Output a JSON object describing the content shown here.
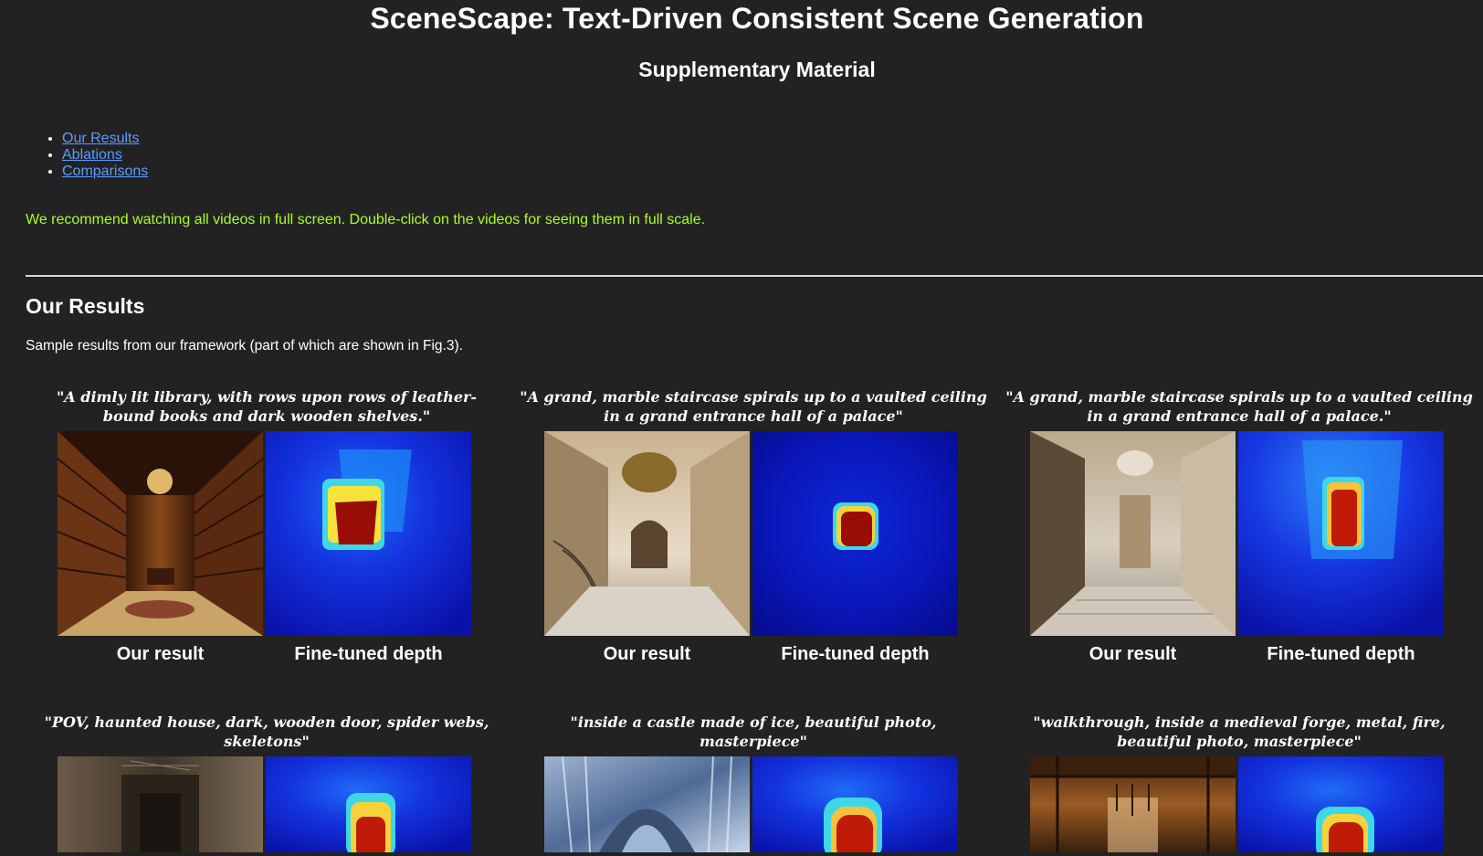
{
  "header": {
    "title": "SceneScape: Text-Driven Consistent Scene Generation",
    "subtitle": "Supplementary Material"
  },
  "nav": {
    "links": [
      "Our Results",
      "Ablations",
      "Comparisons"
    ]
  },
  "notice": "We recommend watching all videos in full screen. Double-click on the videos for seeing them in full scale.",
  "colors": {
    "background": "#222222",
    "link": "#5b9cff",
    "notice": "#aaff22"
  },
  "results": {
    "heading": "Our Results",
    "description": "Sample results from our framework (part of which are shown in Fig.3).",
    "items": [
      {
        "caption_line1": "\"A dimly lit library, with rows upon rows of leather-",
        "caption_line2": "bound books and dark wooden shelves.\"",
        "left_label": "Our result",
        "right_label": "Fine-tuned depth"
      },
      {
        "caption_line1": "\"A grand, marble staircase spirals up to a vaulted ceiling",
        "caption_line2": "in a grand entrance hall of a palace\"",
        "left_label": "Our result",
        "right_label": "Fine-tuned depth"
      },
      {
        "caption_line1": "\"A grand, marble staircase spirals up to a vaulted ceiling",
        "caption_line2": "in a grand entrance hall of a palace.\"",
        "left_label": "Our result",
        "right_label": "Fine-tuned depth"
      },
      {
        "caption_line1": "\"POV, haunted house, dark, wooden door, spider webs,",
        "caption_line2": "skeletons\""
      },
      {
        "caption_line1": "\"inside a castle made of ice, beautiful photo,",
        "caption_line2": "masterpiece\""
      },
      {
        "caption_line1": "\"walkthrough, inside a medieval forge, metal, fire,",
        "caption_line2": "beautiful photo, masterpiece\""
      }
    ]
  }
}
